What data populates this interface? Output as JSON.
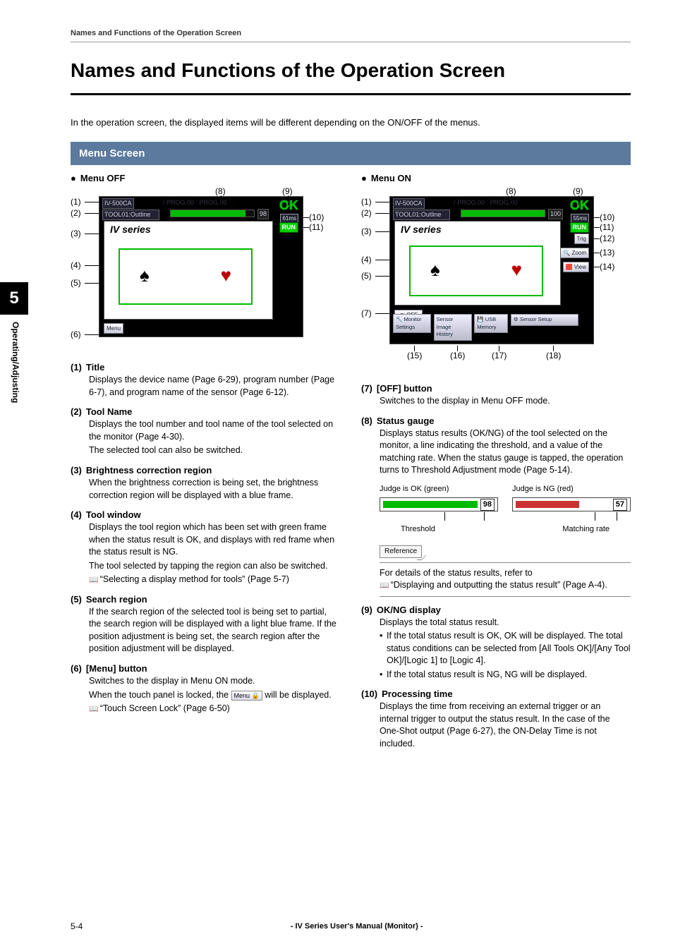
{
  "running_head": "Names and Functions of the Operation Screen",
  "h1": "Names and Functions of the Operation Screen",
  "intro": "In the operation screen, the displayed items will be different depending on the ON/OFF of the menus.",
  "section_bar": "Menu Screen",
  "menu_off_label": "Menu OFF",
  "menu_on_label": "Menu ON",
  "figure": {
    "device_name": "IV-500CA",
    "prog_label": "PROG.00 : PROG.00",
    "tool_line": "TOOL01:Outline",
    "series": "IV series",
    "ok_text": "OK",
    "run_text": "RUN",
    "time_off": "61ms",
    "time_on": "55ms",
    "gauge_off": "98",
    "gauge_on": "100",
    "trig": "Trig",
    "zoom": "🔍 Zoom",
    "view": "View",
    "off_btn": "OFF",
    "menu_btn": "Menu",
    "monitor_settings": "Monitor Settings",
    "sensor_history": "Sensor Image History",
    "usb_memory": "USB Memory",
    "sensor_setup": "Sensor Setup",
    "bottom_nums": [
      "(15)",
      "(16)",
      "(17)",
      "(18)"
    ]
  },
  "left_items": [
    {
      "num": "(1)",
      "title": "Title",
      "body": [
        "Displays the device name (Page 6-29), program number (Page 6-7), and program name of the sensor (Page 6-12)."
      ]
    },
    {
      "num": "(2)",
      "title": "Tool Name",
      "body": [
        "Displays the tool number and tool name of the tool selected on the monitor (Page 4-30).",
        "The selected tool can also be switched."
      ]
    },
    {
      "num": "(3)",
      "title": "Brightness correction region",
      "body": [
        "When the brightness correction is being set, the brightness correction region will be displayed with a blue frame."
      ]
    },
    {
      "num": "(4)",
      "title": "Tool window",
      "body": [
        "Displays the tool region which has been set with green frame when the status result is OK, and displays with red frame when the status result is NG.",
        "The tool selected by tapping the region can also be switched."
      ],
      "ref": "“Selecting a display method for tools” (Page 5-7)"
    },
    {
      "num": "(5)",
      "title": "Search region",
      "body": [
        "If the search region of the selected tool is being set to partial, the search region will be displayed with a light blue frame. If the position adjustment is being set, the search region after the position adjustment will be displayed."
      ]
    },
    {
      "num": "(6)",
      "title": "[Menu] button",
      "body": [
        "Switches to the display in Menu ON mode.",
        "When the touch panel is locked, the |Menu 🔒| will be displayed."
      ],
      "ref": "“Touch Screen Lock” (Page 6-50)"
    }
  ],
  "right_items": [
    {
      "num": "(7)",
      "title": "[OFF] button",
      "body": [
        "Switches to the display in Menu OFF mode."
      ]
    },
    {
      "num": "(8)",
      "title": "Status gauge",
      "body": [
        "Displays status results (OK/NG) of the tool selected on the monitor, a line indicating the threshold, and a value of the matching rate. When the status gauge is tapped, the operation turns to Threshold Adjustment mode (Page 5-14)."
      ]
    }
  ],
  "gauge_demo": {
    "ok_label": "Judge is OK (green)",
    "ng_label": "Judge is NG (red)",
    "ok_value": "98",
    "ng_value": "57",
    "threshold": "Threshold",
    "matching": "Matching rate"
  },
  "ref_box_label": "Reference",
  "status_ref_text": "For details of the status results, refer to",
  "status_ref_link": "“Displaying and outputting the status result” (Page A-4).",
  "right_items_2": [
    {
      "num": "(9)",
      "title": "OK/NG display",
      "body_intro": "Displays the total status result.",
      "bullets": [
        "If the total status result is OK, OK will be displayed. The total status conditions can be selected from [All Tools OK]/[Any Tool OK]/[Logic 1] to [Logic 4].",
        "If the total status result is NG, NG will be displayed."
      ]
    },
    {
      "num": "(10)",
      "title": "Processing time",
      "body": [
        "Displays the time from receiving an external trigger or an internal trigger to output the status result. In the case of the One-Shot output (Page 6-27), the ON-Delay Time is not included."
      ]
    }
  ],
  "chapter_num": "5",
  "chapter_label": "Operating/Adjusting",
  "footer_page": "5-4",
  "footer_center": "- IV Series User's Manual (Monitor) -",
  "menu_lock_icon": "Menu 🔒"
}
